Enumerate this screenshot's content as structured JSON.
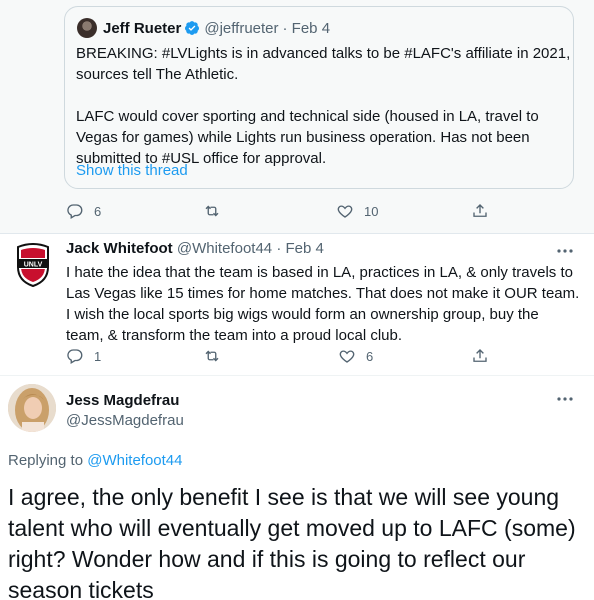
{
  "quoted_tweet": {
    "author_name": "Jeff Rueter",
    "author_handle": "@jeffrueter",
    "date": "· Feb 4",
    "text_lines_1": [
      "BREAKING: #LVLights is in advanced talks to be #LAFC's affiliate in 2021,",
      "sources tell The Athletic."
    ],
    "text_lines_2": [
      "LAFC would cover sporting and technical side (housed in LA, travel to",
      "Vegas for games) while Lights run business operation. Has not been",
      "submitted to #USL office for approval."
    ],
    "show_thread": "Show this thread"
  },
  "tweet1_actions": {
    "reply_count": "6",
    "like_count": "10"
  },
  "tweet2": {
    "author_name": "Jack Whitefoot",
    "author_handle": "@Whitefoot44",
    "date": "· Feb 4",
    "text_lines": [
      "I hate the idea that the team is based in LA, practices in LA, & only travels to",
      "Las Vegas like 15 times for home matches. That does not make it OUR team.",
      "I wish the local sports big wigs would form an ownership group, buy the",
      "team, & transform the team into a proud local club."
    ],
    "reply_count": "1",
    "like_count": "6"
  },
  "main_tweet": {
    "author_name": "Jess Magdefrau",
    "author_handle": "@JessMagdefrau",
    "replying_prefix": "Replying to ",
    "replying_to": "@Whitefoot44",
    "text_lines": [
      "I agree, the only benefit I see is that we will see young",
      "talent who will eventually get moved up to LAFC (some)",
      "right? Wonder how and if this is going to reflect our",
      "season tickets"
    ]
  },
  "colors": {
    "accent": "#1d9bf0",
    "muted": "#536471",
    "text": "#0f1419"
  }
}
